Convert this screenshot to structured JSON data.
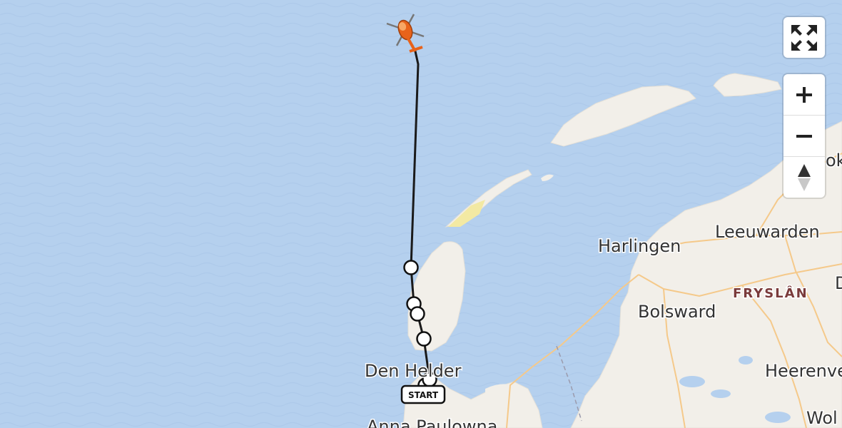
{
  "map": {
    "labels": {
      "harlingen": "Harlingen",
      "leeuwarden": "Leeuwarden",
      "fryslan": "FRYSLÂN",
      "bolsward": "Bolsward",
      "den_helder": "Den Helder",
      "heerenveen": "Heerenve",
      "anna_paulowna": "Anna Paulowna",
      "dokkum": "ok",
      "drachten": "D",
      "wolvega": "Wol"
    },
    "start_marker": "START",
    "route_color": "#1a1a1a",
    "water_color": "#b5d0ee",
    "land_color": "#f2efe9",
    "road_color": "#f5c98a",
    "helicopter_color": "#e8631a"
  },
  "controls": {
    "fullscreen": "fullscreen-icon",
    "zoom_in": "plus-icon",
    "zoom_out": "minus-icon",
    "reset_north": "compass-icon"
  }
}
